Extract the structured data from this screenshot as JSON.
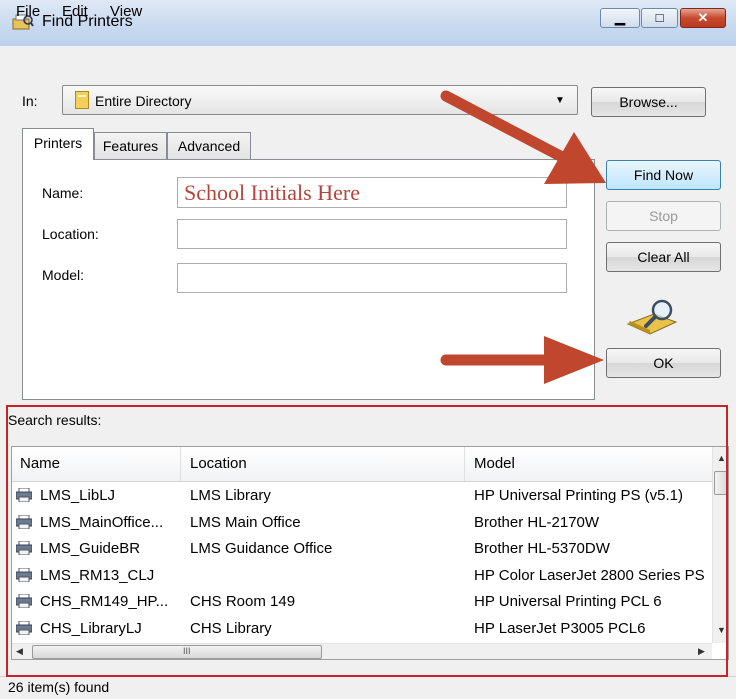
{
  "window": {
    "title": "Find Printers",
    "min_glyph": "▁",
    "max_glyph": "□",
    "close_glyph": "✕"
  },
  "menu": [
    "File",
    "Edit",
    "View"
  ],
  "in_row": {
    "label": "In:",
    "value": "Entire Directory",
    "browse_label": "Browse..."
  },
  "tabs": [
    "Printers",
    "Features",
    "Advanced"
  ],
  "form": {
    "name_label": "Name:",
    "name_value": "School Initials Here",
    "location_label": "Location:",
    "location_value": "",
    "model_label": "Model:",
    "model_value": ""
  },
  "buttons": {
    "find_now": "Find Now",
    "stop": "Stop",
    "clear_all": "Clear All",
    "ok": "OK"
  },
  "results": {
    "label": "Search results:",
    "columns": [
      "Name",
      "Location",
      "Model"
    ],
    "rows": [
      {
        "name": "LMS_LibLJ",
        "location": "LMS Library",
        "model": "HP Universal Printing PS (v5.1)"
      },
      {
        "name": "LMS_MainOffice...",
        "location": "LMS Main Office",
        "model": "Brother HL-2170W"
      },
      {
        "name": "LMS_GuideBR",
        "location": "LMS Guidance Office",
        "model": "Brother HL-5370DW"
      },
      {
        "name": "LMS_RM13_CLJ",
        "location": "",
        "model": "HP Color LaserJet 2800 Series PS"
      },
      {
        "name": "CHS_RM149_HP...",
        "location": "CHS Room 149",
        "model": "HP Universal Printing PCL 6"
      },
      {
        "name": "CHS_LibraryLJ",
        "location": "CHS Library",
        "model": "HP LaserJet P3005 PCL6"
      }
    ],
    "hscroll_grip": "III"
  },
  "status": "26 item(s) found",
  "colors": {
    "arrow": "#c0462d",
    "highlight_border": "#c7232a",
    "name_text": "#b5443c"
  }
}
